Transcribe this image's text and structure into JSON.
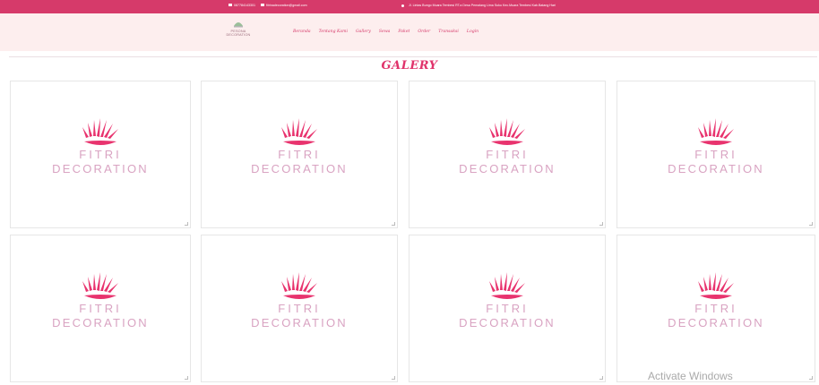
{
  "topbar": {
    "phone": "087784143301",
    "email": "fitrinadecoration@gmail.com",
    "address": "Jl. Lintas Bungo Muara Tembesi RT.a Desa Pemalang Lima Suku Kec.Muara Tembesi Kab.Batang Hari"
  },
  "brand": {
    "name": "PESONA DECORATION"
  },
  "nav": {
    "items": [
      "Beranda",
      "Tentang Kami",
      "Gallery",
      "Sewa",
      "Paket",
      "Order",
      "Transaksi",
      "Login"
    ]
  },
  "page": {
    "title": "GALERY"
  },
  "gallery": {
    "brand_line1": "FITRI",
    "brand_line2": "DECORATION",
    "count": 8
  },
  "watermark": {
    "text": "Activate Windows"
  },
  "colors": {
    "accent": "#d63a6a",
    "logo": "#e8336e",
    "nav_bg": "#fdeeee",
    "brand_text": "#d9a3c2"
  },
  "icons": {
    "phone": "phone-icon",
    "email": "mail-icon",
    "address": "location-icon",
    "card_logo": "leaf-icon"
  }
}
